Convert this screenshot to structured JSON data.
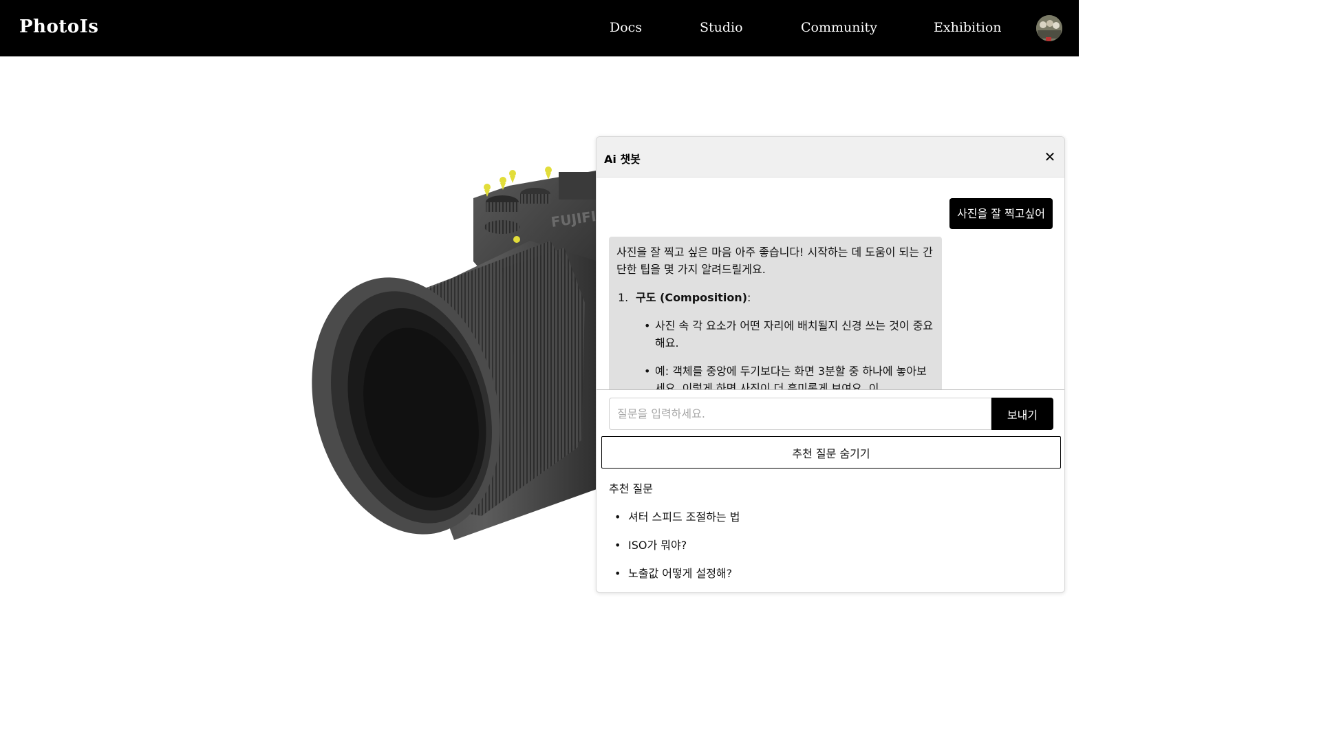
{
  "header": {
    "logo": "PhotoIs",
    "nav": [
      {
        "label": "Docs"
      },
      {
        "label": "Studio"
      },
      {
        "label": "Community"
      },
      {
        "label": "Exhibition"
      }
    ],
    "avatar_icon": "user-avatar"
  },
  "camera": {
    "brand_text": "FUJIFILM",
    "hotspot_icon": "yellow-pin-icon",
    "hotspot_color": "#e2dd3a"
  },
  "chat": {
    "title": "Ai 챗봇",
    "close_icon": "✕",
    "user_message": "사진을 잘 찍고싶어",
    "bot_intro": "사진을 잘 찍고 싶은 마음 아주 좋습니다! 시작하는 데 도움이 되는 간단한 팁을 몇 가지 알려드릴게요.",
    "bot_list": [
      {
        "number": "1.",
        "title": "구도 (Composition)",
        "suffix": ":",
        "bullets": [
          "사진 속 각 요소가 어떤 자리에 배치될지 신경 쓰는 것이 중요해요.",
          "예: 객체를 중앙에 두기보다는 화면 3분할 중 하나에 놓아보세요. 이렇게 하면 사진이 더 흥미롭게 보여요. 이"
        ]
      }
    ],
    "input_placeholder": "질문을 입력하세요.",
    "send_label": "보내기",
    "toggle_label": "추천 질문 숨기기",
    "suggest_title": "추천 질문",
    "suggestions": [
      "셔터 스피드 조절하는 법",
      "ISO가 뭐야?",
      "노출값 어떻게 설정해?"
    ],
    "colors": {
      "header_bg": "#f0f0f0",
      "bot_bubble": "#e0e0e0",
      "user_bubble": "#000000"
    }
  }
}
